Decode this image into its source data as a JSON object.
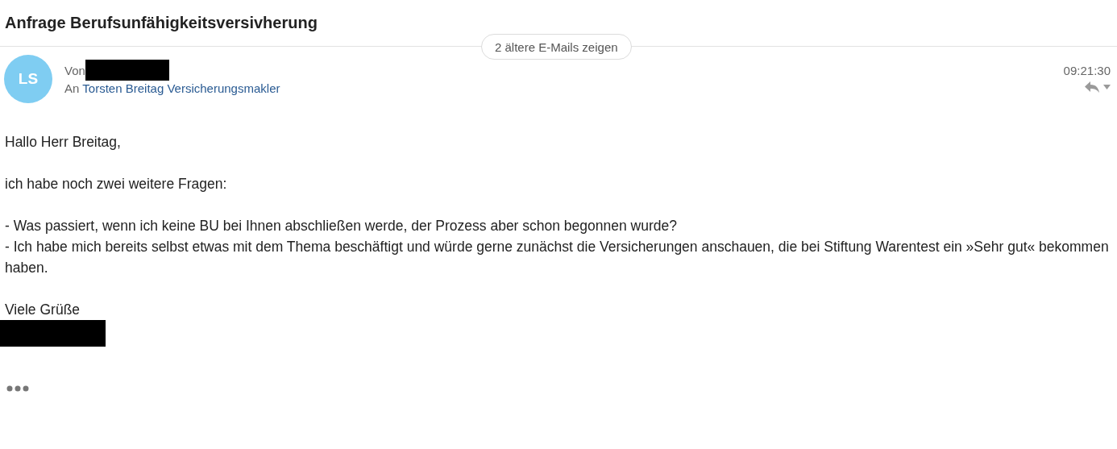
{
  "subject": "Anfrage Berufsunfähigkeitsversivherung",
  "older_button": "2 ältere E-Mails zeigen",
  "message": {
    "avatar": "LS",
    "from_label": "Von",
    "to_label": "An",
    "to": "Torsten Breitag Versicherungsmakler",
    "time": "09:21:30",
    "body": [
      "Hallo Herr Breitag,",
      "ich habe noch zwei weitere Fragen:",
      "- Was passiert, wenn ich keine BU bei Ihnen abschließen werde, der Prozess aber schon begonnen wurde?\n- Ich habe mich bereits selbst etwas mit dem Thema beschäftigt und würde gerne zunächst die Versicherungen anschauen, die bei Stiftung Warentest ein »Sehr gut« bekommen haben.",
      "Viele Grüße"
    ]
  }
}
